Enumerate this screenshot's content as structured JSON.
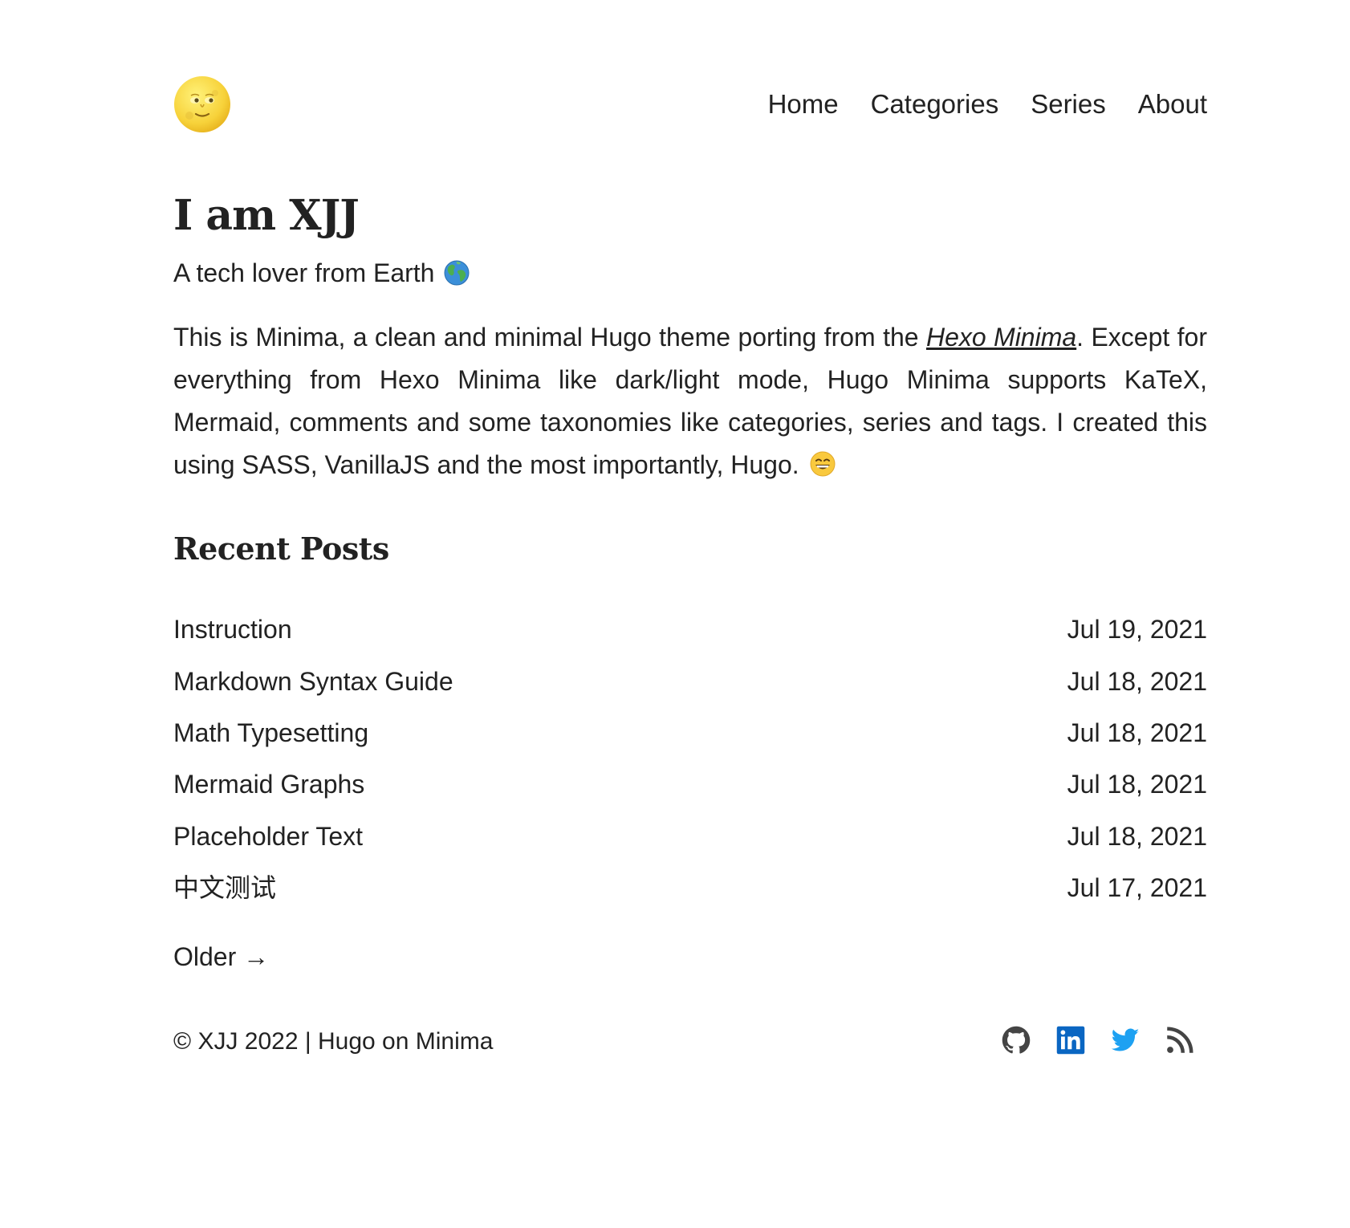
{
  "header": {
    "logo_icon": "full-moon-face-icon",
    "nav": [
      {
        "label": "Home"
      },
      {
        "label": "Categories"
      },
      {
        "label": "Series"
      },
      {
        "label": "About"
      }
    ]
  },
  "intro": {
    "title": "I am XJJ",
    "subtitle": "A tech lover from Earth",
    "subtitle_icon": "earth-globe-icon",
    "paragraph_before_link": "This is Minima, a clean and minimal Hugo theme porting from the ",
    "link_text": "Hexo Minima",
    "paragraph_after_link": ". Except for everything from Hexo Minima like dark/light mode, Hugo Minima supports KaTeX, Mermaid, comments and some taxonomies like categories, series and tags. I created this using SASS, VanillaJS and the most importantly, Hugo. ",
    "paragraph_icon": "grinning-face-icon"
  },
  "recent": {
    "title": "Recent Posts",
    "posts": [
      {
        "title": "Instruction",
        "date": "Jul 19, 2021"
      },
      {
        "title": "Markdown Syntax Guide",
        "date": "Jul 18, 2021"
      },
      {
        "title": "Math Typesetting",
        "date": "Jul 18, 2021"
      },
      {
        "title": "Mermaid Graphs",
        "date": "Jul 18, 2021"
      },
      {
        "title": "Placeholder Text",
        "date": "Jul 18, 2021"
      },
      {
        "title": "中文测试",
        "date": "Jul 17, 2021"
      }
    ],
    "older_label": "Older →"
  },
  "footer": {
    "copyright": "© XJJ 2022 | Hugo on Minima",
    "socials": [
      {
        "icon": "github-icon",
        "color": "#444444"
      },
      {
        "icon": "linkedin-icon",
        "color": "#0a66c2"
      },
      {
        "icon": "twitter-icon",
        "color": "#1da1f2"
      },
      {
        "icon": "rss-icon",
        "color": "#444444"
      }
    ]
  }
}
